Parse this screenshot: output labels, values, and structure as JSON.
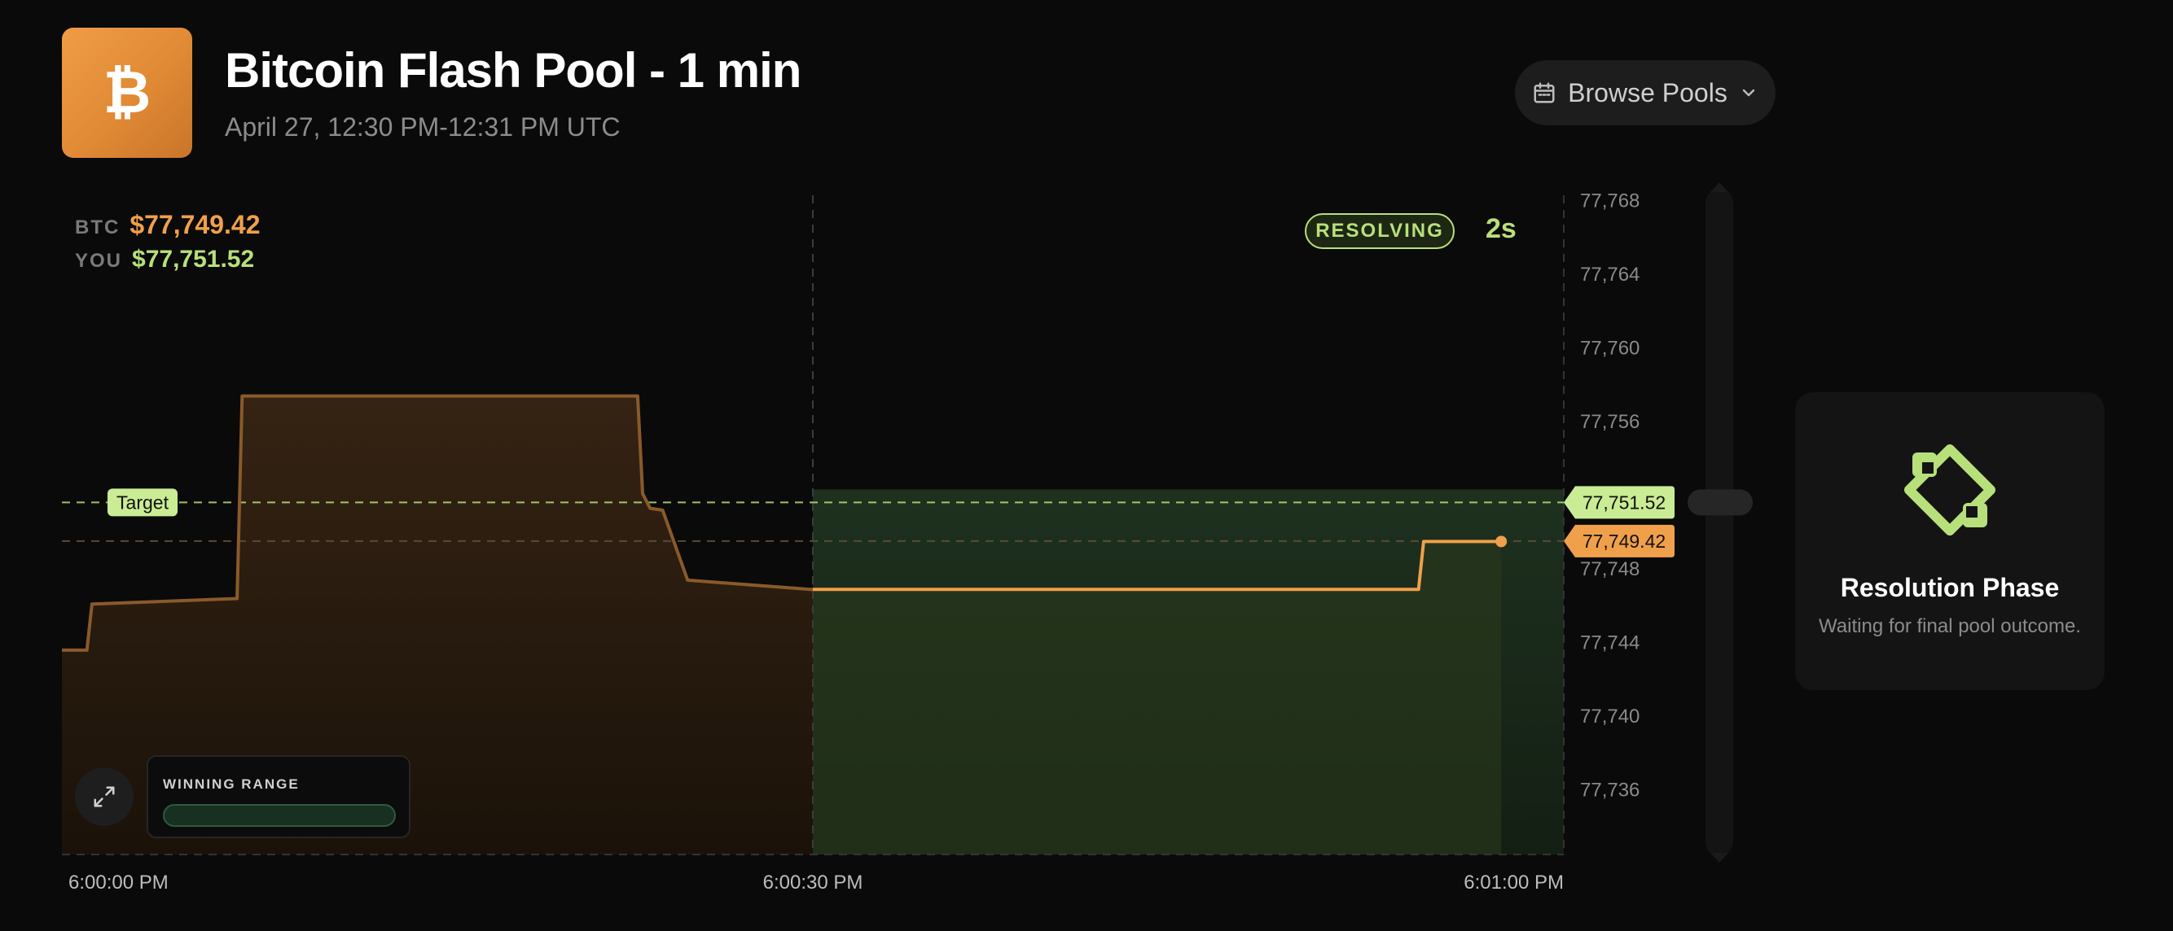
{
  "header": {
    "logo_icon": "bitcoin-icon",
    "logo_glyph": "₿",
    "title": "Bitcoin Flash Pool - 1 min",
    "subtitle": "April 27, 12:30 PM-12:31 PM UTC",
    "browse_label": "Browse Pools",
    "browse_icon": "calendar-icon",
    "browse_chevron": "chevron-down-icon"
  },
  "legend": {
    "btc_tag": "BTC",
    "btc_value": "$77,749.42",
    "you_tag": "YOU",
    "you_value": "$77,751.52"
  },
  "status": {
    "badge": "RESOLVING",
    "countdown": "2s"
  },
  "chart_data": {
    "type": "line",
    "y_ticks": [
      "77,768",
      "77,764",
      "77,760",
      "77,756",
      "77,748",
      "77,744",
      "77,740",
      "77,736"
    ],
    "x_ticks": [
      "6:00:00 PM",
      "6:00:30 PM",
      "6:01:00 PM"
    ],
    "target_label": "Target",
    "target_value": "77,751.52",
    "current_value": "77,749.42",
    "ylim": [
      77732.4,
      77768.2
    ],
    "series": [
      {
        "points": [
          [
            0,
            77743.5
          ],
          [
            1.0,
            77743.5
          ],
          [
            1.2,
            77746
          ],
          [
            7.0,
            77746.3
          ],
          [
            7.2,
            77757.3
          ],
          [
            23.0,
            77757.3
          ],
          [
            23.2,
            77752
          ],
          [
            23.5,
            77751.2
          ],
          [
            24.0,
            77751.1
          ],
          [
            25.0,
            77747.3
          ],
          [
            29.9,
            77746.8
          ],
          [
            30.0,
            77746.8
          ],
          [
            54.2,
            77746.8
          ],
          [
            54.4,
            77749.4
          ],
          [
            57.5,
            77749.4
          ]
        ]
      }
    ],
    "highlight_start": 30,
    "highlight_end": 60,
    "x_range": [
      0,
      60
    ]
  },
  "controls": {
    "expand_icon": "expand-icon",
    "winning_range_label": "WINNING RANGE"
  },
  "panel": {
    "icon": "resolution-icon",
    "title": "Resolution Phase",
    "subtitle": "Waiting for final pool outcome."
  },
  "colors": {
    "accent_orange": "#f0a04b",
    "accent_green": "#b8e07a"
  }
}
